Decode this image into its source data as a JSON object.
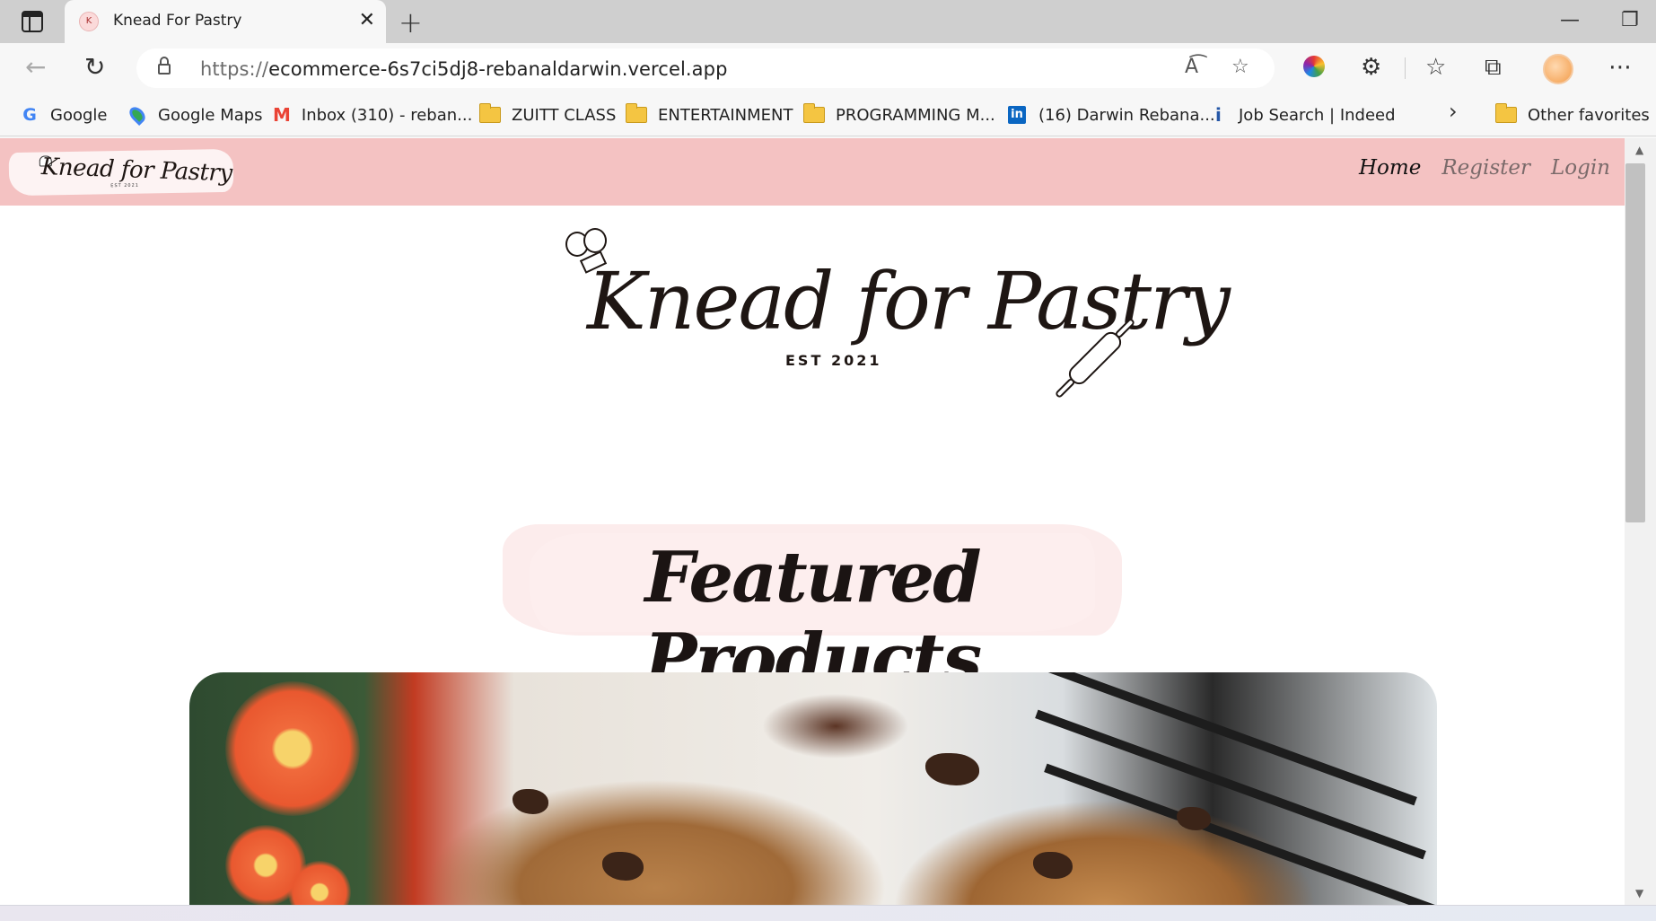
{
  "browser": {
    "tab": {
      "title": "Knead For Pastry",
      "favicon_glyph": "K"
    },
    "new_tab_glyph": "+",
    "address": {
      "scheme": "https://",
      "host": "ecommerce-6s7ci5dj8-rebanaldarwin.vercel.app"
    },
    "favorites": [
      {
        "label": "Google",
        "icon": "google-icon"
      },
      {
        "label": "Google Maps",
        "icon": "google-maps-icon"
      },
      {
        "label": "Inbox (310) - reban...",
        "icon": "gmail-icon"
      },
      {
        "label": "ZUITT CLASS",
        "icon": "folder-icon"
      },
      {
        "label": "ENTERTAINMENT",
        "icon": "folder-icon"
      },
      {
        "label": "PROGRAMMING M...",
        "icon": "folder-icon"
      },
      {
        "label": "(16) Darwin Rebana...",
        "icon": "linkedin-icon"
      },
      {
        "label": "Job Search | Indeed",
        "icon": "indeed-icon"
      }
    ],
    "other_favorites": "Other favorites"
  },
  "site": {
    "navbar": {
      "logo_text": "Knead for Pastry",
      "logo_sub": "EST 2021",
      "links": [
        {
          "label": "Home",
          "active": true
        },
        {
          "label": "Register",
          "active": false
        },
        {
          "label": "Login",
          "active": false
        }
      ]
    },
    "hero": {
      "title": "Knead for Pastry",
      "subtitle": "EST 2021"
    },
    "featured": {
      "heading": "Featured Products"
    },
    "product_image": {
      "subject": "chocolate chip cookies on cooling rack"
    }
  },
  "colors": {
    "navbar_bg": "#f4c2c2",
    "brush_bg": "#fcebeb",
    "ink": "#1e1613",
    "inactive_link": "#7a6a6a"
  }
}
